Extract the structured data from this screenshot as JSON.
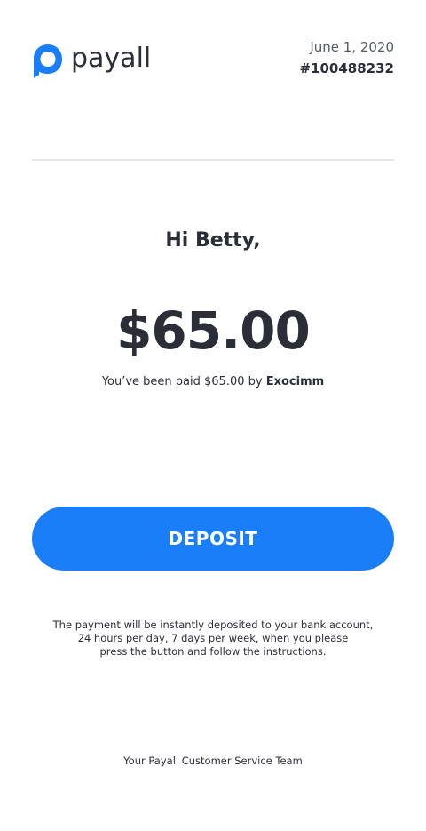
{
  "brand": {
    "name": "payall",
    "accent_color": "#1a7ef8",
    "logo_icon": "payall-logo-icon"
  },
  "header": {
    "date": "June 1, 2020",
    "order_number": "#100488232"
  },
  "main": {
    "greeting": "Hi Betty,",
    "amount": "$65.00",
    "paid_prefix": "You’ve been paid $65.00 by",
    "payer": "Exocimm"
  },
  "action": {
    "deposit_label": "DEPOSIT"
  },
  "info": {
    "lines": [
      "The payment will be instantly deposited to your bank account,",
      "24 hours per day, 7 days per week, when you please",
      "press the button and follow the instructions."
    ]
  },
  "footer": {
    "signoff": "Your Payall Customer Service Team"
  }
}
